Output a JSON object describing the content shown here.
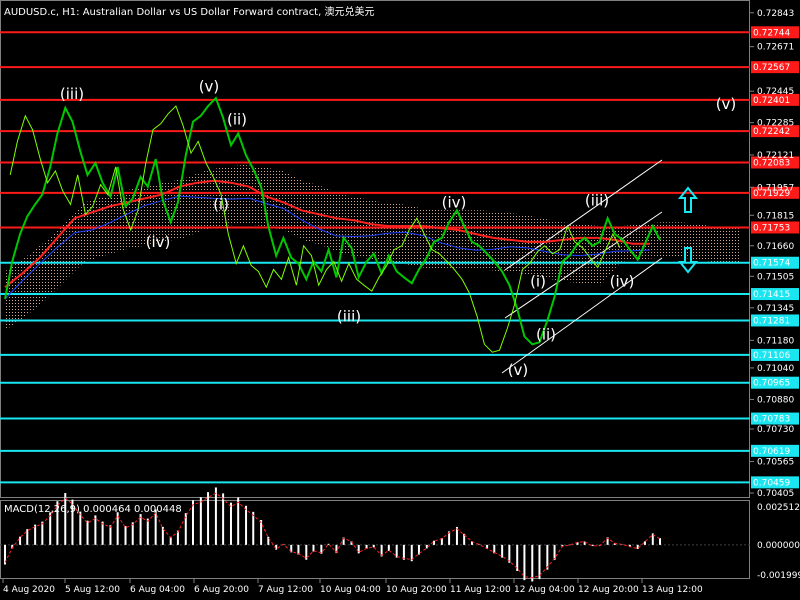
{
  "header": {
    "title": "AUDUSD.c, H1:  Australian Dollar vs US Dollar Forward contract, 澳元兑美元",
    "macd_label": "MACD(12,26,9) 0.000464 0.000448"
  },
  "colors": {
    "background": "#000000",
    "price_line": "#00c800",
    "resistance_line": "#ff1a1a",
    "support_line": "#19e6f0",
    "kijun_line": "#ff2020",
    "tenkan_line": "#2040ff",
    "chikou_line": "#7fff00",
    "cloud": "#f5c6a8",
    "arrow": "#19e6f0",
    "channel": "#ffffff",
    "macd_hist": "#ffffff",
    "macd_signal": "#ff2020"
  },
  "chart_data": {
    "type": "line",
    "symbol": "AUDUSD.c",
    "timeframe": "H1",
    "ylim": [
      0.70405,
      0.72847
    ],
    "y_ticks": [
      "0.72843",
      "0.72671",
      "0.72445",
      "0.72285",
      "0.72121",
      "0.71957",
      "0.71815",
      "0.71660",
      "0.71505",
      "0.71345",
      "0.71180",
      "0.71040",
      "0.70880",
      "0.70730",
      "0.70565",
      "0.70405"
    ],
    "x_ticks": [
      "4 Aug 2020",
      "5 Aug 12:00",
      "6 Aug 04:00",
      "6 Aug 20:00",
      "7 Aug 12:00",
      "10 Aug 04:00",
      "10 Aug 20:00",
      "11 Aug 12:00",
      "12 Aug 04:00",
      "12 Aug 20:00",
      "13 Aug 12:00"
    ],
    "resistance_levels": [
      "0.72744",
      "0.72567",
      "0.72401",
      "0.72242",
      "0.72083",
      "0.71929",
      "0.71753"
    ],
    "support_levels": [
      "0.71574",
      "0.71415",
      "0.71281",
      "0.71106",
      "0.70965",
      "0.70783",
      "0.70619",
      "0.70459"
    ],
    "price": [
      0.7139,
      0.7158,
      0.7172,
      0.7181,
      0.7187,
      0.7192,
      0.7206,
      0.7223,
      0.7236,
      0.7229,
      0.7214,
      0.7202,
      0.7208,
      0.7198,
      0.7191,
      0.7206,
      0.7186,
      0.719,
      0.7201,
      0.7196,
      0.721,
      0.7189,
      0.7178,
      0.7188,
      0.7212,
      0.7229,
      0.7232,
      0.7237,
      0.7241,
      0.7231,
      0.7217,
      0.7223,
      0.7212,
      0.7205,
      0.7196,
      0.7176,
      0.7161,
      0.717,
      0.716,
      0.7157,
      0.7149,
      0.7158,
      0.7153,
      0.7164,
      0.715,
      0.717,
      0.7165,
      0.715,
      0.7158,
      0.7162,
      0.7152,
      0.7161,
      0.7153,
      0.715,
      0.7147,
      0.7154,
      0.716,
      0.7168,
      0.717,
      0.7178,
      0.7184,
      0.7176,
      0.7168,
      0.7166,
      0.7162,
      0.7158,
      0.7153,
      0.7146,
      0.7134,
      0.712,
      0.7116,
      0.7117,
      0.7128,
      0.714,
      0.7158,
      0.7161,
      0.7167,
      0.717,
      0.7166,
      0.7168,
      0.718,
      0.7172,
      0.7169,
      0.7164,
      0.7159,
      0.7167,
      0.7176,
      0.7169
    ],
    "price_x": [
      0.0,
      0.011,
      0.023,
      0.034,
      0.046,
      0.057,
      0.069,
      0.08,
      0.092,
      0.103,
      0.115,
      0.126,
      0.138,
      0.149,
      0.161,
      0.172,
      0.184,
      0.195,
      0.207,
      0.218,
      0.23,
      0.241,
      0.253,
      0.264,
      0.276,
      0.287,
      0.299,
      0.31,
      0.322,
      0.333,
      0.345,
      0.356,
      0.368,
      0.379,
      0.391,
      0.402,
      0.414,
      0.425,
      0.437,
      0.448,
      0.46,
      0.471,
      0.483,
      0.494,
      0.506,
      0.517,
      0.529,
      0.54,
      0.552,
      0.563,
      0.575,
      0.586,
      0.598,
      0.609,
      0.621,
      0.632,
      0.644,
      0.655,
      0.667,
      0.678,
      0.69,
      0.701,
      0.713,
      0.724,
      0.736,
      0.747,
      0.759,
      0.77,
      0.782,
      0.793,
      0.805,
      0.816,
      0.828,
      0.839,
      0.851,
      0.862,
      0.874,
      0.885,
      0.897,
      0.908,
      0.92,
      0.931,
      0.943,
      0.954,
      0.966,
      0.977,
      0.989,
      1.0
    ],
    "kijun": [
      0.7145,
      0.7152,
      0.716,
      0.717,
      0.718,
      0.7183,
      0.7186,
      0.7188,
      0.719,
      0.7192,
      0.7196,
      0.7198,
      0.7199,
      0.7198,
      0.7196,
      0.7191,
      0.7188,
      0.7184,
      0.7182,
      0.718,
      0.7179,
      0.7177,
      0.7176,
      0.7176,
      0.7176,
      0.7175,
      0.7174,
      0.7172,
      0.717,
      0.7169,
      0.7168,
      0.7168,
      0.7169,
      0.717,
      0.717,
      0.7169,
      0.7167,
      0.7167
    ],
    "elliott_labels": [
      {
        "text": "(iii)",
        "price": 0.7243
      },
      {
        "text": "(v)",
        "price": 0.7247
      },
      {
        "text": "(ii)",
        "price": 0.723
      },
      {
        "text": "(i)",
        "price": 0.7187
      },
      {
        "text": "(iv)",
        "price": 0.7168
      },
      {
        "text": "(iii)",
        "price": 0.713
      },
      {
        "text": "(iv)",
        "price": 0.7188
      },
      {
        "text": "(i)",
        "price": 0.7148
      },
      {
        "text": "(ii)",
        "price": 0.7121
      },
      {
        "text": "(v)",
        "price": 0.7103
      },
      {
        "text": "(iii)",
        "price": 0.7189
      },
      {
        "text": "(iv)",
        "price": 0.7148
      },
      {
        "text": "(v)",
        "price": 0.7238
      }
    ],
    "macd": {
      "ylim": [
        -0.001999,
        0.002512
      ],
      "y_ticks": [
        "0.002512",
        "0.000000",
        "-0.001999"
      ]
    }
  }
}
